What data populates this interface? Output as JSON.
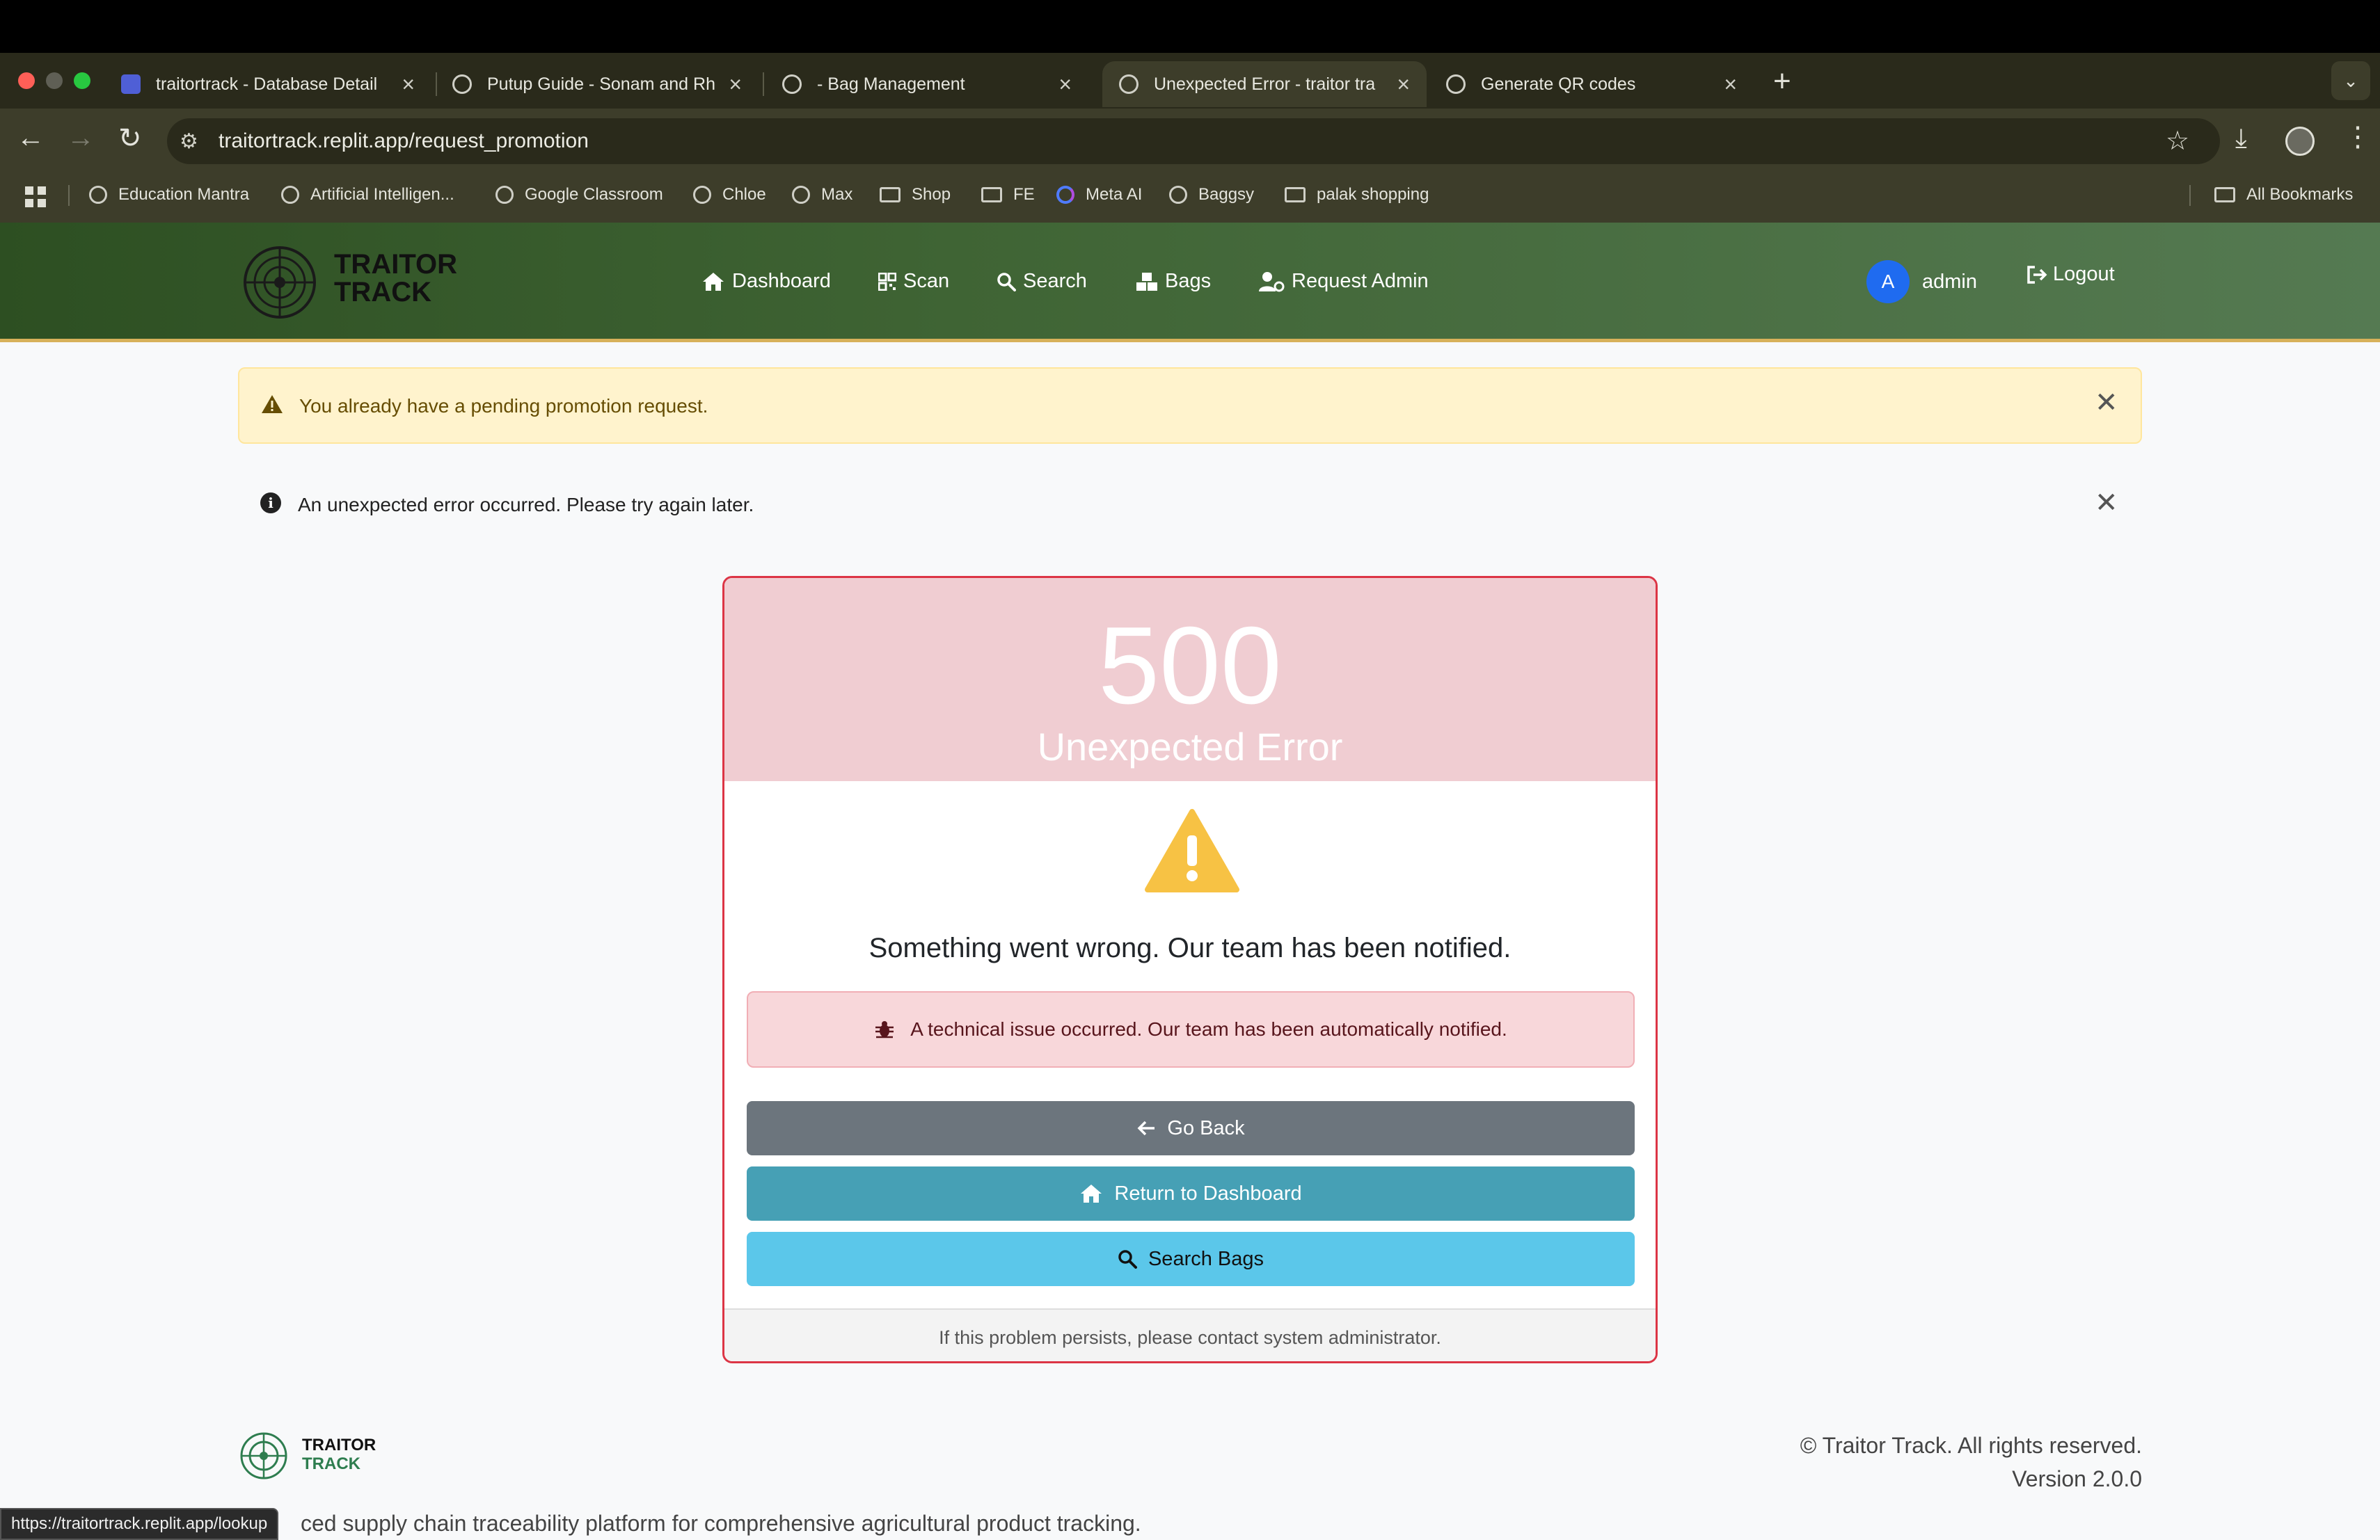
{
  "browser": {
    "tabs": [
      {
        "title": "traitortrack - Database Detail",
        "active": false
      },
      {
        "title": "Putup Guide - Sonam and Rh",
        "active": false
      },
      {
        "title": "- Bag Management",
        "active": false
      },
      {
        "title": "Unexpected Error - traitor tra",
        "active": true
      },
      {
        "title": "Generate QR codes",
        "active": false
      }
    ],
    "url": "traitortrack.replit.app/request_promotion",
    "bookmarks": [
      "Education Mantra",
      "Artificial Intelligen...",
      "Google Classroom",
      "Chloe",
      "Max",
      "Shop",
      "FE",
      "Meta AI",
      "Baggsy",
      "palak shopping"
    ],
    "all_bookmarks": "All Bookmarks",
    "status_url": "https://traitortrack.replit.app/lookup"
  },
  "site": {
    "brand": {
      "line1": "TRAITOR",
      "line2": "TRACK"
    },
    "nav": [
      {
        "label": "Dashboard",
        "icon": "home-icon"
      },
      {
        "label": "Scan",
        "icon": "qr-icon"
      },
      {
        "label": "Search",
        "icon": "search-icon"
      },
      {
        "label": "Bags",
        "icon": "boxes-icon"
      },
      {
        "label": "Request Admin",
        "icon": "user-gear-icon"
      }
    ],
    "user": {
      "initial": "A",
      "name": "admin"
    },
    "logout_label": "Logout"
  },
  "alerts": {
    "warning": "You already have a pending promotion request.",
    "info": "An unexpected error occurred. Please try again later."
  },
  "error_card": {
    "code": "500",
    "title": "Unexpected Error",
    "message": "Something went wrong. Our team has been notified.",
    "detail": "A technical issue occurred. Our team has been automatically notified.",
    "buttons": {
      "back": "Go Back",
      "dashboard": "Return to Dashboard",
      "search": "Search Bags"
    },
    "footer": "If this problem persists, please contact system administrator."
  },
  "footer": {
    "brand": {
      "line1": "TRAITOR",
      "line2": "TRACK"
    },
    "copyright": "© Traitor Track. All rights reserved.",
    "version": "Version 2.0.0",
    "tagline": "ced supply chain traceability platform for comprehensive agricultural product tracking."
  },
  "colors": {
    "nav_gradient_start": "#2d4f22",
    "nav_gradient_end": "#557a52",
    "danger": "#dc3545",
    "warning_bg": "#fff3cd",
    "info_button": "#46a0b5",
    "secondary_button": "#6c757d",
    "search_button": "#5bc7ea"
  }
}
